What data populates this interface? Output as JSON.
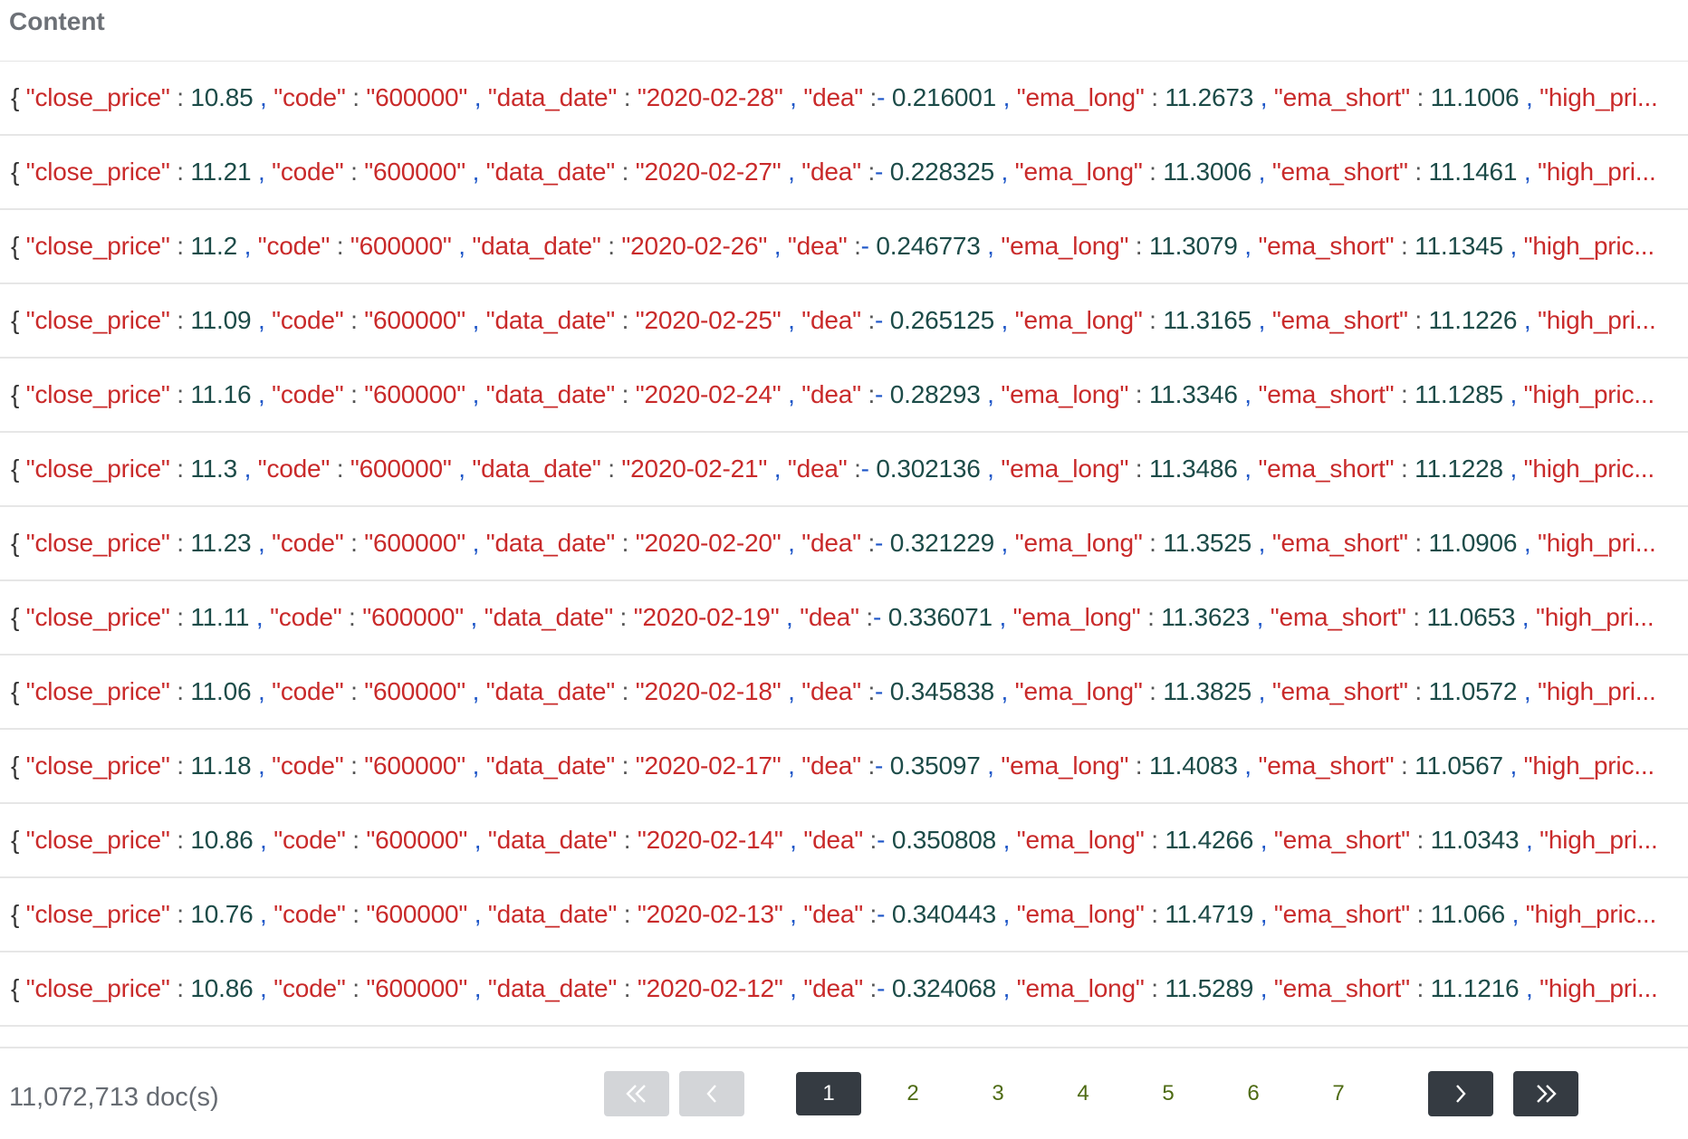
{
  "header": {
    "title": "Content"
  },
  "rows": [
    {
      "close_price": "10.85",
      "code": "600000",
      "data_date": "2020-02-28",
      "dea": "0.216001",
      "ema_long": "11.2673",
      "ema_short": "11.1006",
      "tail": "\"high_pri..."
    },
    {
      "close_price": "11.21",
      "code": "600000",
      "data_date": "2020-02-27",
      "dea": "0.228325",
      "ema_long": "11.3006",
      "ema_short": "11.1461",
      "tail": "\"high_pri..."
    },
    {
      "close_price": "11.2",
      "code": "600000",
      "data_date": "2020-02-26",
      "dea": "0.246773",
      "ema_long": "11.3079",
      "ema_short": "11.1345",
      "tail": "\"high_pric..."
    },
    {
      "close_price": "11.09",
      "code": "600000",
      "data_date": "2020-02-25",
      "dea": "0.265125",
      "ema_long": "11.3165",
      "ema_short": "11.1226",
      "tail": "\"high_pri..."
    },
    {
      "close_price": "11.16",
      "code": "600000",
      "data_date": "2020-02-24",
      "dea": "0.28293",
      "ema_long": "11.3346",
      "ema_short": "11.1285",
      "tail": "\"high_pric..."
    },
    {
      "close_price": "11.3",
      "code": "600000",
      "data_date": "2020-02-21",
      "dea": "0.302136",
      "ema_long": "11.3486",
      "ema_short": "11.1228",
      "tail": "\"high_pric..."
    },
    {
      "close_price": "11.23",
      "code": "600000",
      "data_date": "2020-02-20",
      "dea": "0.321229",
      "ema_long": "11.3525",
      "ema_short": "11.0906",
      "tail": "\"high_pri..."
    },
    {
      "close_price": "11.11",
      "code": "600000",
      "data_date": "2020-02-19",
      "dea": "0.336071",
      "ema_long": "11.3623",
      "ema_short": "11.0653",
      "tail": "\"high_pri..."
    },
    {
      "close_price": "11.06",
      "code": "600000",
      "data_date": "2020-02-18",
      "dea": "0.345838",
      "ema_long": "11.3825",
      "ema_short": "11.0572",
      "tail": "\"high_pri..."
    },
    {
      "close_price": "11.18",
      "code": "600000",
      "data_date": "2020-02-17",
      "dea": "0.35097",
      "ema_long": "11.4083",
      "ema_short": "11.0567",
      "tail": "\"high_pric..."
    },
    {
      "close_price": "10.86",
      "code": "600000",
      "data_date": "2020-02-14",
      "dea": "0.350808",
      "ema_long": "11.4266",
      "ema_short": "11.0343",
      "tail": "\"high_pri..."
    },
    {
      "close_price": "10.76",
      "code": "600000",
      "data_date": "2020-02-13",
      "dea": "0.340443",
      "ema_long": "11.4719",
      "ema_short": "11.066",
      "tail": "\"high_pric..."
    },
    {
      "close_price": "10.86",
      "code": "600000",
      "data_date": "2020-02-12",
      "dea": "0.324068",
      "ema_long": "11.5289",
      "ema_short": "11.1216",
      "tail": "\"high_pri..."
    }
  ],
  "footer": {
    "doc_count": "11,072,713 doc(s)",
    "pages": [
      "1",
      "2",
      "3",
      "4",
      "5",
      "6",
      "7"
    ],
    "current_page": "1",
    "first_icon": "double-chevron-left-icon",
    "prev_icon": "chevron-left-icon",
    "next_icon": "chevron-right-icon",
    "last_icon": "double-chevron-right-icon"
  },
  "colors": {
    "key": "#c92a2a",
    "number": "#1c4b48",
    "comma": "#1f57c8",
    "active_page_bg": "#353b42",
    "page_link": "#4e6b13",
    "disabled_button": "#d3d5d8"
  }
}
